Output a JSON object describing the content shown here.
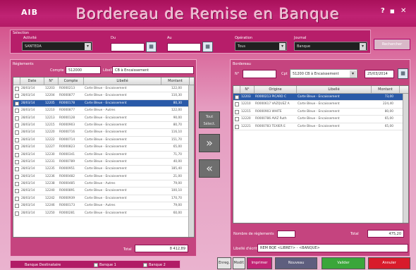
{
  "app": {
    "logo": "AIB",
    "title": "Bordereau de Remise en Banque",
    "ctrl_help": "?",
    "ctrl_min": "■",
    "ctrl_close": "✕"
  },
  "filters": {
    "section": "Sélection",
    "activite_label": "Activité",
    "activite_value": "SANTEDA",
    "du_label": "Du",
    "au_label": "Au",
    "operation_label": "Opération",
    "operation_value": "Tous",
    "journal_label": "Journal",
    "journal_value": "Banque",
    "side_button": "Rechercher"
  },
  "left": {
    "section": "Réglements",
    "compte_label": "Compte",
    "compte_value": "512000",
    "libelle_label": "Libellé",
    "libelle_value": "CB à Encaissement",
    "columns": [
      "",
      "Date",
      "N°",
      "Compte",
      "Libellé",
      "Montant"
    ],
    "rows": [
      {
        "date": "28/03/14",
        "num": "12203",
        "compte": "R0000213",
        "libelle": "Carte Bleue - Encaissement",
        "montant": "122,00"
      },
      {
        "date": "28/03/14",
        "num": "12204",
        "compte": "R0000877",
        "libelle": "Carte Bleue - Encaissement",
        "montant": "110,30"
      },
      {
        "date": "28/03/14",
        "num": "12205",
        "compte": "R0000178",
        "libelle": "Carte Bleue - Encaissement",
        "montant": "80,30"
      },
      {
        "date": "28/03/14",
        "num": "12210",
        "compte": "R0000877",
        "libelle": "Carte Bleue - Autres",
        "montant": "122,00"
      },
      {
        "date": "28/03/14",
        "num": "12213",
        "compte": "R0000128",
        "libelle": "Carte Bleue - Encaissement",
        "montant": "90,00"
      },
      {
        "date": "28/03/14",
        "num": "12215",
        "compte": "R0000903",
        "libelle": "Carte Bleue - Encaissement",
        "montant": "80,70"
      },
      {
        "date": "28/03/14",
        "num": "12220",
        "compte": "R0000716",
        "libelle": "Carte Bleue - Encaissement",
        "montant": "116,10"
      },
      {
        "date": "28/03/14",
        "num": "12222",
        "compte": "R0000714",
        "libelle": "Carte Bleue - Encaissement",
        "montant": "151,70"
      },
      {
        "date": "28/03/14",
        "num": "12227",
        "compte": "R0000823",
        "libelle": "Carte Bleue - Encaissement",
        "montant": "65,00"
      },
      {
        "date": "28/03/14",
        "num": "12230",
        "compte": "R0000341",
        "libelle": "Carte Bleue - Encaissement",
        "montant": "71,70"
      },
      {
        "date": "28/03/14",
        "num": "12231",
        "compte": "R0000789",
        "libelle": "Carte Bleue - Encaissement",
        "montant": "40,00"
      },
      {
        "date": "28/03/14",
        "num": "12235",
        "compte": "R0000951",
        "libelle": "Carte Bleue - Encaissement",
        "montant": "185,40"
      },
      {
        "date": "28/03/14",
        "num": "12236",
        "compte": "R0000482",
        "libelle": "Carte Bleue - Encaissement",
        "montant": "21,00"
      },
      {
        "date": "28/03/14",
        "num": "12238",
        "compte": "R0000485",
        "libelle": "Carte Bleue - Autres",
        "montant": "79,00"
      },
      {
        "date": "28/03/14",
        "num": "12240",
        "compte": "R0000891",
        "libelle": "Carte Bleue - Encaissement",
        "montant": "100,10"
      },
      {
        "date": "28/03/14",
        "num": "12242",
        "compte": "R0000939",
        "libelle": "Carte Bleue - Encaissement",
        "montant": "170,70"
      },
      {
        "date": "28/03/14",
        "num": "12246",
        "compte": "R0000173",
        "libelle": "Carte Bleue - Autres",
        "montant": "79,00"
      },
      {
        "date": "28/03/14",
        "num": "12250",
        "compte": "R0000281",
        "libelle": "Carte Bleue - Encaissement",
        "montant": "60,00"
      }
    ],
    "total_label": "Total",
    "total_value": "8 412,89"
  },
  "mid": {
    "top_label": "Tout Sélect.",
    "add_label": "»",
    "remove_label": "«"
  },
  "right": {
    "section": "Bordereau",
    "num_label": "N°",
    "num_value": "",
    "cpte_label": "Cpt",
    "cpte_value": "51200 CB à Encaissement",
    "date_value": "25/03/2014",
    "columns": [
      "",
      "N°",
      "Origine",
      "Libellé",
      "Montant"
    ],
    "rows": [
      {
        "num": "12203",
        "origine": "R0000213 PICARD C",
        "libelle": "Carte Bleue - Encaissement",
        "montant": "73,00"
      },
      {
        "num": "12210",
        "origine": "R0000617 VAZQUEZ A",
        "libelle": "Carte Bleue - Encaissement",
        "montant": "224,40"
      },
      {
        "num": "12215",
        "origine": "R0000903 WHITE",
        "libelle": "Carte Bleue - Encaissement",
        "montant": "80,00"
      },
      {
        "num": "12220",
        "origine": "R0000786 AVIZ Ruth",
        "libelle": "Carte Bleue - Encaissement",
        "montant": "65,00"
      },
      {
        "num": "12221",
        "origine": "R0000783 TEXIER E",
        "libelle": "Carte Bleue - Encaissement",
        "montant": "65,00"
      }
    ],
    "nb_label": "Nombre de règlements",
    "total_label": "Total",
    "total_value": "475,20",
    "ecriture_label": "Libellé d'écriture",
    "ecriture_value": "REM BQE <LIBRE?> - <BANQUE>"
  },
  "bottom": {
    "banque_label": "Banque Destinataire",
    "opt1": "Banque 1",
    "opt2": "Banque 2",
    "btn_print": "Imprimer",
    "btn_new": "Nouveau",
    "btn_valider": "Valider",
    "btn_annuler": "Annuler",
    "btn_save": "Enreg.",
    "btn_modif": "Modif."
  }
}
